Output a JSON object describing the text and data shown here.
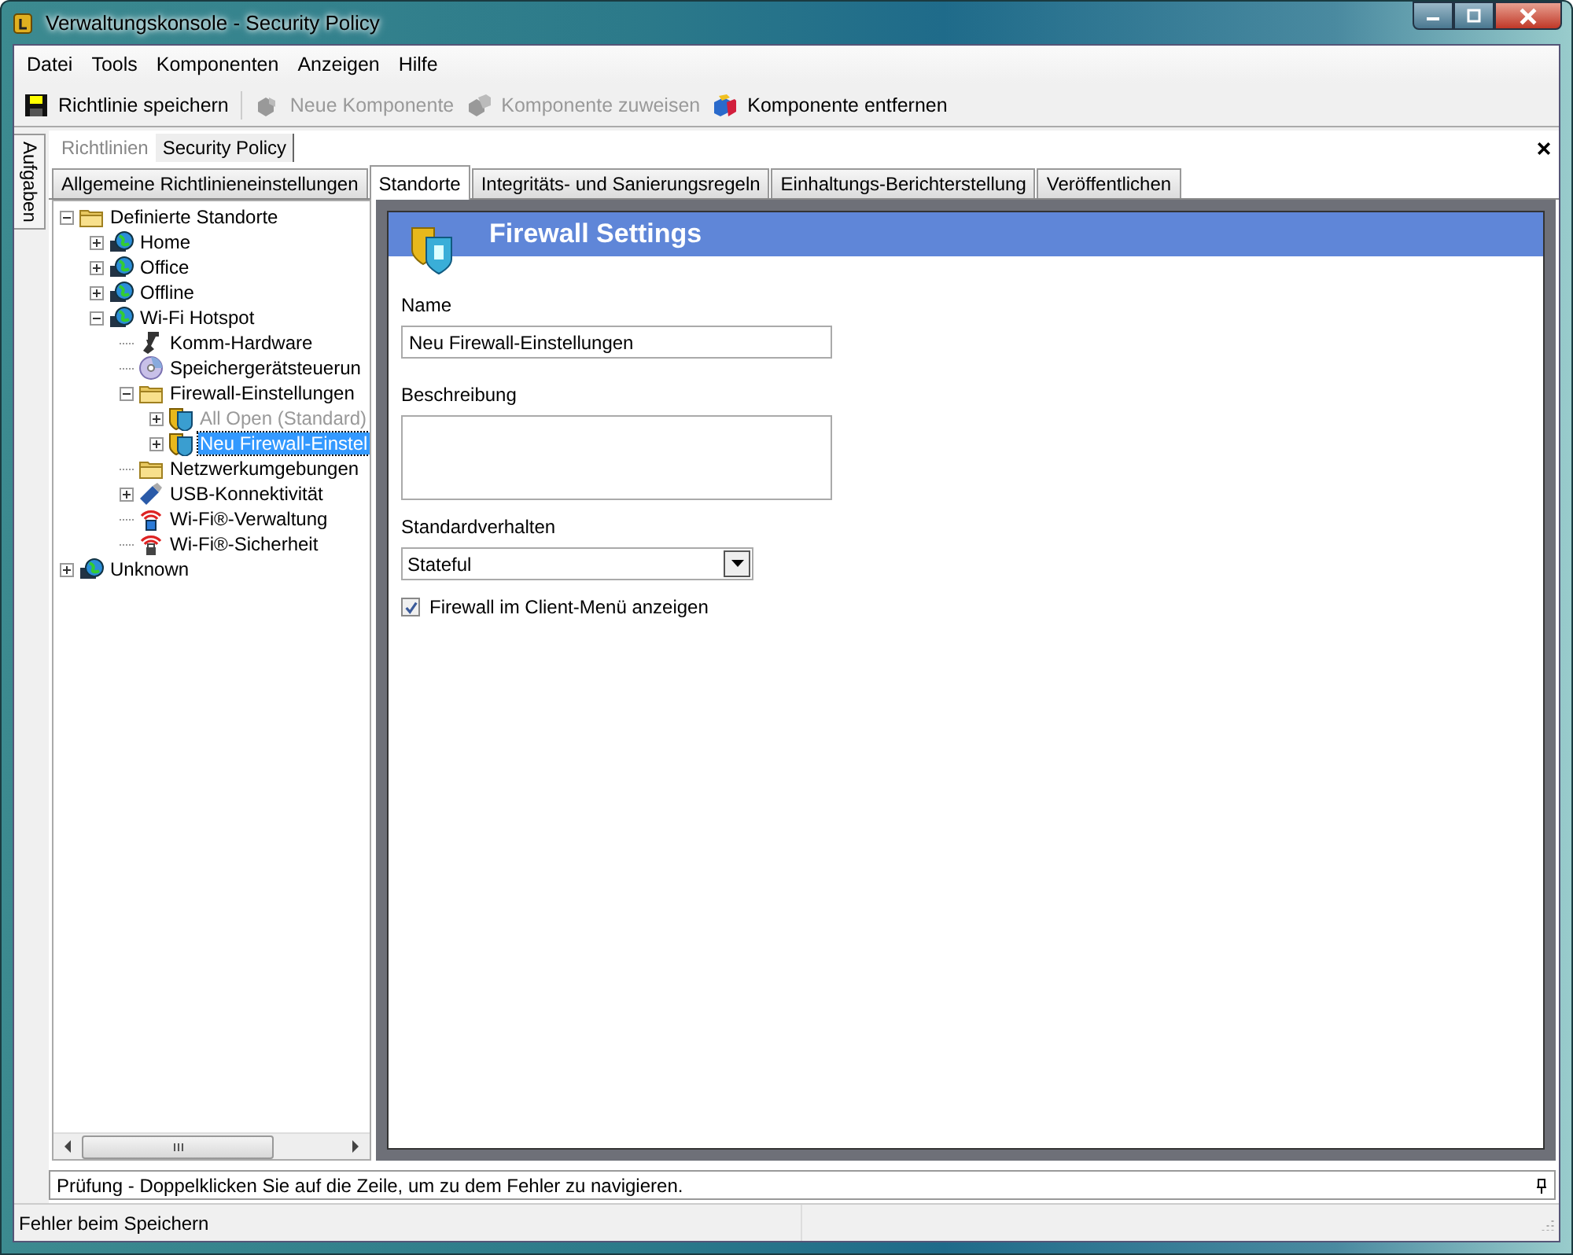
{
  "window": {
    "title": "Verwaltungskonsole - Security Policy"
  },
  "menu": [
    "Datei",
    "Tools",
    "Komponenten",
    "Anzeigen",
    "Hilfe"
  ],
  "toolbar": [
    {
      "label": "Richtlinie speichern",
      "disabled": false
    },
    {
      "label": "Neue Komponente",
      "disabled": true
    },
    {
      "label": "Komponente zuweisen",
      "disabled": true
    },
    {
      "label": "Komponente entfernen",
      "disabled": false
    }
  ],
  "side_tab": "Aufgaben",
  "document_tabs": [
    {
      "label": "Richtlinien",
      "selected": false
    },
    {
      "label": "Security Policy",
      "selected": true
    }
  ],
  "tabs": [
    {
      "label": "Allgemeine Richtlinieneinstellungen",
      "selected": false
    },
    {
      "label": "Standorte",
      "selected": true
    },
    {
      "label": "Integritäts- und Sanierungsregeln",
      "selected": false
    },
    {
      "label": "Einhaltungs-Berichterstellung",
      "selected": false
    },
    {
      "label": "Veröffentlichen",
      "selected": false
    }
  ],
  "tree": [
    {
      "label": "Definierte Standorte",
      "kind": "folder",
      "expanded": true,
      "selected": false,
      "disabled": false,
      "children": [
        {
          "label": "Home",
          "kind": "globe",
          "expanded": false,
          "selected": false,
          "disabled": false
        },
        {
          "label": "Office",
          "kind": "globe",
          "expanded": false,
          "selected": false,
          "disabled": false
        },
        {
          "label": "Offline",
          "kind": "globe",
          "expanded": false,
          "selected": false,
          "disabled": false
        },
        {
          "label": "Wi-Fi Hotspot",
          "kind": "globe",
          "expanded": true,
          "selected": false,
          "disabled": false,
          "children": [
            {
              "label": "Komm-Hardware",
              "kind": "hardware",
              "selected": false,
              "disabled": false
            },
            {
              "label": "Speichergerätsteuerun",
              "kind": "disc",
              "selected": false,
              "disabled": false
            },
            {
              "label": "Firewall-Einstellungen",
              "kind": "folder",
              "expanded": true,
              "selected": false,
              "disabled": false,
              "children": [
                {
                  "label": "All Open (Standard)",
                  "kind": "firewall",
                  "expanded": false,
                  "selected": false,
                  "disabled": true
                },
                {
                  "label": "Neu Firewall-Einstel",
                  "kind": "firewall",
                  "expanded": false,
                  "selected": true,
                  "disabled": false
                }
              ]
            },
            {
              "label": "Netzwerkumgebungen",
              "kind": "folder",
              "selected": false,
              "disabled": false
            },
            {
              "label": "USB-Konnektivität",
              "kind": "usb",
              "expanded": false,
              "selected": false,
              "disabled": false
            },
            {
              "label": "Wi-Fi®-Verwaltung",
              "kind": "wifi",
              "selected": false,
              "disabled": false
            },
            {
              "label": "Wi-Fi®-Sicherheit",
              "kind": "wifi-lock",
              "selected": false,
              "disabled": false
            }
          ]
        }
      ]
    },
    {
      "label": "Unknown",
      "kind": "globe",
      "expanded": false,
      "selected": false,
      "disabled": false
    }
  ],
  "panel": {
    "title": "Firewall Settings",
    "fields": [
      {
        "kind": "text",
        "label": "Name",
        "value": "Neu Firewall-Einstellungen"
      },
      {
        "kind": "textarea",
        "label": "Beschreibung"
      },
      {
        "kind": "dropdown",
        "label": "Standardverhalten",
        "value": "Stateful"
      },
      {
        "kind": "checkbox",
        "label": "Firewall im Client-Menü anzeigen",
        "checked": true
      }
    ]
  },
  "output_bar": {
    "text": "Prüfung - Doppelklicken Sie auf die Zeile, um zu dem Fehler zu navigieren."
  },
  "status_bar": {
    "text": "Fehler beim Speichern"
  }
}
